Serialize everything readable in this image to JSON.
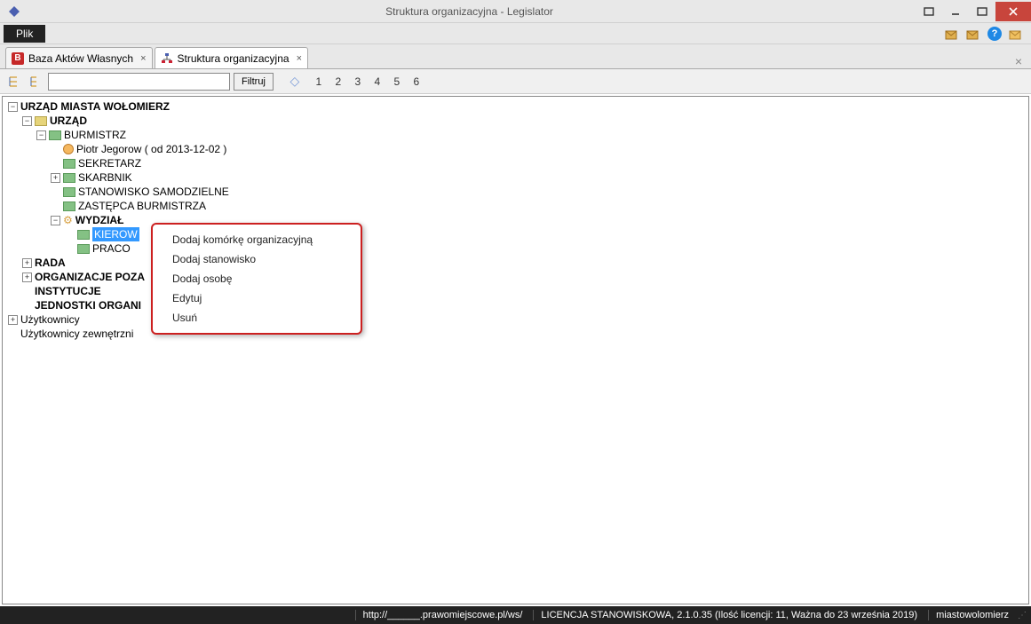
{
  "title": "Struktura organizacyjna - Legislator",
  "menu": {
    "plik": "Plik"
  },
  "tabs": [
    {
      "label": "Baza Aktów Własnych",
      "icon_text": "B"
    },
    {
      "label": "Struktura organizacyjna",
      "icon_text": ""
    }
  ],
  "toolbar": {
    "filter_label": "Filtruj",
    "numbers": [
      "1",
      "2",
      "3",
      "4",
      "5",
      "6"
    ]
  },
  "tree": {
    "root": "URZĄD MIASTA WOŁOMIERZ",
    "urzad": "URZĄD",
    "burmistrz": "BURMISTRZ",
    "piotr": "Piotr Jegorow ( od 2013-12-02 )",
    "sekretarz": "SEKRETARZ",
    "skarbnik": "SKARBNIK",
    "stanowisko": "STANOWISKO SAMODZIELNE",
    "zastepca": "ZASTĘPCA BURMISTRZA",
    "wydzial": "WYDZIAŁ",
    "kierow": "KIEROW",
    "praco": "PRACO",
    "rada": "RADA",
    "organizacje": "ORGANIZACJE POZA",
    "instytucje": "INSTYTUCJE",
    "jednostki": "JEDNOSTKI ORGANI",
    "uzytkownicy": "Użytkownicy",
    "uzytkownicy_zew": "Użytkownicy zewnętrzni"
  },
  "ctx": {
    "dodaj_komorke": "Dodaj komórkę organizacyjną",
    "dodaj_stanowisko": "Dodaj stanowisko",
    "dodaj_osobe": "Dodaj osobę",
    "edytuj": "Edytuj",
    "usun": "Usuń"
  },
  "status": {
    "url": "http://______.prawomiejscowe.pl/ws/",
    "licencja": "LICENCJA STANOWISKOWA, 2.1.0.35 (Ilość licencji: 11, Ważna do 23 września 2019)",
    "miasto": "miastowolomierz"
  }
}
